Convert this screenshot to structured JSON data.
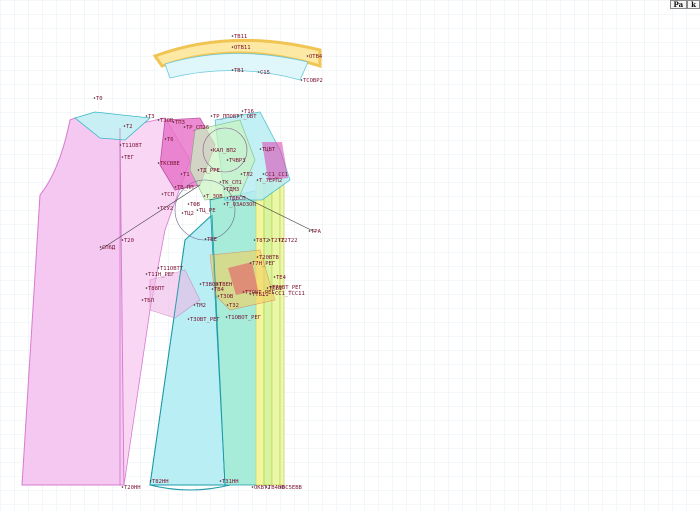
{
  "toolbar": {
    "tabs": [
      "Pa",
      "k"
    ]
  },
  "colors": {
    "grid": "#d6e6ec",
    "front_piece": "#f4c8f0",
    "sleeve_piece": "#b8eef4",
    "yoke_piece": "#e8f4a0",
    "label": "#7a1030",
    "outline": "#1a9aa8"
  },
  "labels": [
    "Т0",
    "Т3",
    "Т3ОВ",
    "ТПЗ",
    "Т2",
    "Т11ОВТ",
    "Т6",
    "ТР_ППОВТ",
    "Т16",
    "Т_ОВТ",
    "ТР_СП26",
    "ТЦВТ",
    "ТКСВВЕ",
    "КАЛ_ВП2",
    "ТЧВРЗ",
    "ТД_РРЕ",
    "ТЛ2",
    "СС1_СС1",
    "Т1",
    "ТК_СП1",
    "ТДМ3",
    "Т_7ЕРП2",
    "ТВ_ПП",
    "ТСП",
    "Т_ЗОВ",
    "ТЦ_РЕ",
    "ТДВСП",
    "ТФВ",
    "Т_ОЗАОЗОП",
    "ТВЕ",
    "ТЕГ",
    "ТСУ2",
    "ТЦ2",
    "СП6Д",
    "Т20",
    "Т8Т2",
    "Т2Т2",
    "Т2Т22",
    "Т20ВТВ",
    "Т7Н_РЕГ",
    "Т11ОВТТ",
    "Т11Н_РЕГ",
    "Т88ПТ",
    "ТЕ4",
    "ТПВ1",
    "Т7ОВТ_РЕГ",
    "ТТБ11",
    "ТБЛ",
    "СС1_ТСС11",
    "Т7ОВТ_РЕГ",
    "ТМ2",
    "Т3ОВТ_РЕГ",
    "Т32",
    "Т1ОВОТ_РЕГ",
    "ТВЕН",
    "ТЗВОВТ",
    "ТЗОВ",
    "ТВ4",
    "ТВ11",
    "ОТВ11",
    "ТВ1",
    "ОТВ4",
    "С15",
    "ТСОВР2",
    "Т20НН",
    "Т82НН",
    "Т31НН",
    "ОКВТ2",
    "ТВ4ВВ",
    "ОС5ЕВВ",
    "ТРА"
  ]
}
